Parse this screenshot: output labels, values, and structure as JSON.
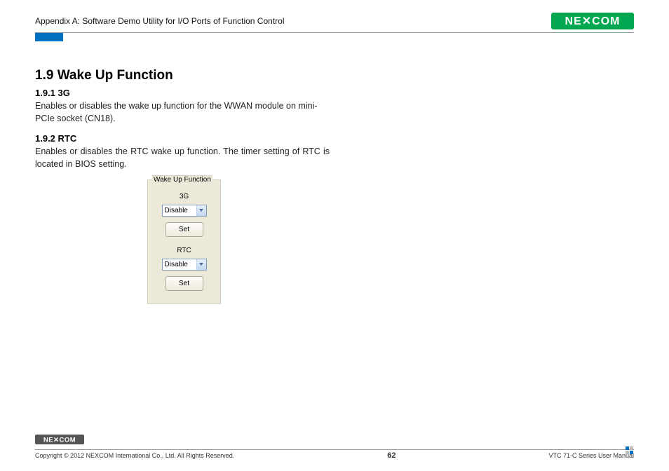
{
  "header": {
    "title": "Appendix A: Software Demo Utility for I/O Ports of Function Control",
    "brand": "NEXCOM"
  },
  "section": {
    "number_title": "1.9  Wake Up Function",
    "sub1": {
      "heading": "1.9.1  3G",
      "text": "Enables or disables the wake up function for the WWAN module on mini-PCIe socket (CN18)."
    },
    "sub2": {
      "heading": "1.9.2  RTC",
      "text": "Enables or disables the RTC wake up function. The timer setting of RTC is located in BIOS setting."
    }
  },
  "panel": {
    "legend": "Wake Up Function",
    "group1": {
      "label": "3G",
      "value": "Disable",
      "button": "Set"
    },
    "group2": {
      "label": "RTC",
      "value": "Disable",
      "button": "Set"
    }
  },
  "footer": {
    "copyright": "Copyright © 2012 NEXCOM International Co., Ltd. All Rights Reserved.",
    "page": "62",
    "doc": "VTC 71-C Series User Manual",
    "brand": "NEXCOM"
  },
  "colors": {
    "blue_tab": "#0070c0",
    "logo_green": "#00a650",
    "logo_blue": "#0070c0",
    "panel_bg": "#ece9d8"
  }
}
